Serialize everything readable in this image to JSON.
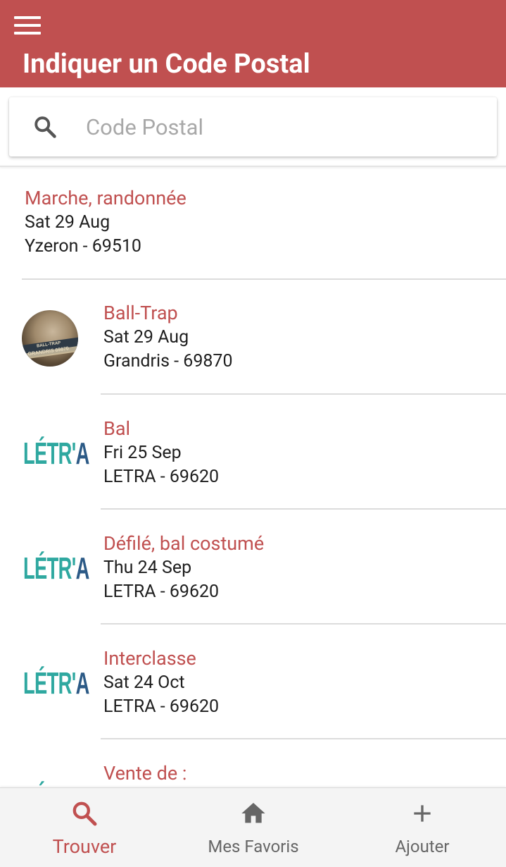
{
  "header": {
    "title": "Indiquer un Code Postal"
  },
  "search": {
    "placeholder": "Code Postal",
    "value": ""
  },
  "items": [
    {
      "title": "Marche, randonnée",
      "date": "Sat 29 Aug",
      "place": "Yzeron - 69510",
      "thumb": "none"
    },
    {
      "title": "Ball-Trap",
      "date": "Sat 29 Aug",
      "place": "Grandris - 69870",
      "thumb": "ball-trap-photo",
      "thumb_text": [
        "BALL-TRAP",
        "GRANDRIS 69870"
      ]
    },
    {
      "title": "Bal",
      "date": "Fri 25 Sep",
      "place": "LETRA - 69620",
      "thumb": "letra-logo"
    },
    {
      "title": "Défilé, bal costumé",
      "date": "Thu 24 Sep",
      "place": "LETRA - 69620",
      "thumb": "letra-logo"
    },
    {
      "title": "Interclasse",
      "date": "Sat 24 Oct",
      "place": "LETRA - 69620",
      "thumb": "letra-logo"
    },
    {
      "title": "Vente de :",
      "date": "",
      "place": "",
      "thumb": "letra-logo"
    }
  ],
  "logo": {
    "letra_main": "LÉTR'",
    "letra_accent": "A"
  },
  "nav": [
    {
      "label": "Trouver",
      "icon": "search-icon",
      "active": true
    },
    {
      "label": "Mes Favoris",
      "icon": "home-icon",
      "active": false
    },
    {
      "label": "Ajouter",
      "icon": "plus-icon",
      "active": false
    }
  ],
  "colors": {
    "primary": "#c05050",
    "title_text": "#c05050",
    "body_text": "#1e1e1e",
    "nav_inactive": "#666666",
    "letra_teal": "#2fa8a0",
    "letra_blue": "#2c5a86"
  }
}
